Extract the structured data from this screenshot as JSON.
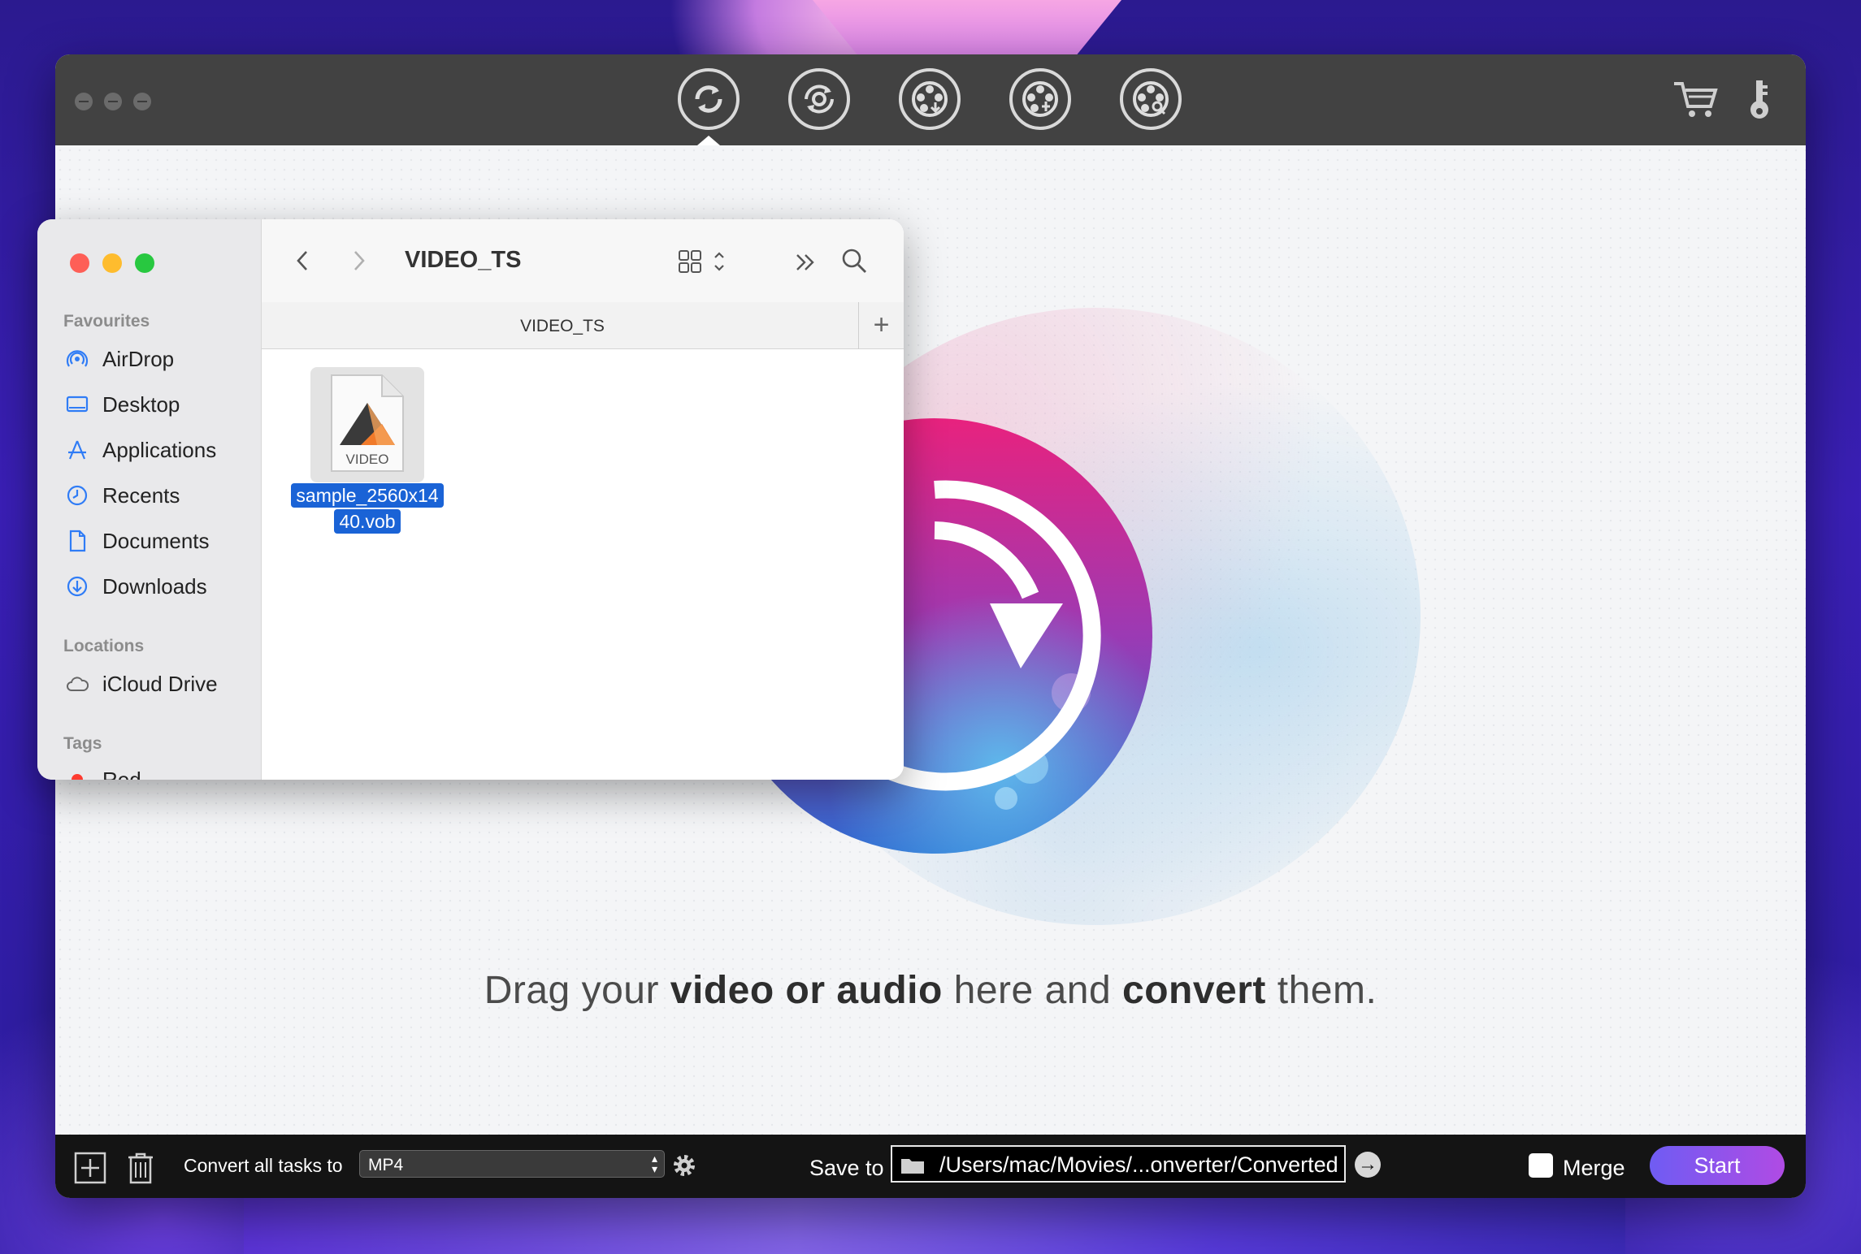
{
  "app": {
    "toolbar_icons": [
      "convert-icon",
      "rotate-icon",
      "film-download-icon",
      "film-compress-icon",
      "film-edit-icon"
    ],
    "right_icons": [
      "cart-icon",
      "key-icon"
    ]
  },
  "main": {
    "hint_pre": "Drag your ",
    "hint_bold1": "video or audio",
    "hint_mid": " here and ",
    "hint_bold2": "convert",
    "hint_post": " them."
  },
  "bottom": {
    "convert_label": "Convert all tasks to",
    "format": "MP4",
    "save_label": "Save to",
    "path": "/Users/mac/Movies/...onverter/Converted",
    "merge_label": "Merge",
    "start_label": "Start"
  },
  "finder": {
    "title": "VIDEO_TS",
    "tab": "VIDEO_TS",
    "sections": {
      "favourites": "Favourites",
      "locations": "Locations",
      "tags": "Tags"
    },
    "favourites": [
      "AirDrop",
      "Desktop",
      "Applications",
      "Recents",
      "Documents",
      "Downloads"
    ],
    "locations": [
      "iCloud Drive"
    ],
    "tags": [
      "Red"
    ],
    "file": {
      "badge": "VIDEO",
      "name_line1": "sample_2560x14",
      "name_line2": "40.vob"
    }
  },
  "colors": {
    "accent": "#1a63d6",
    "start_from": "#6f5cf3",
    "start_to": "#b04be4",
    "logo_from": "#e8227e",
    "logo_to": "#3b5ac8"
  }
}
